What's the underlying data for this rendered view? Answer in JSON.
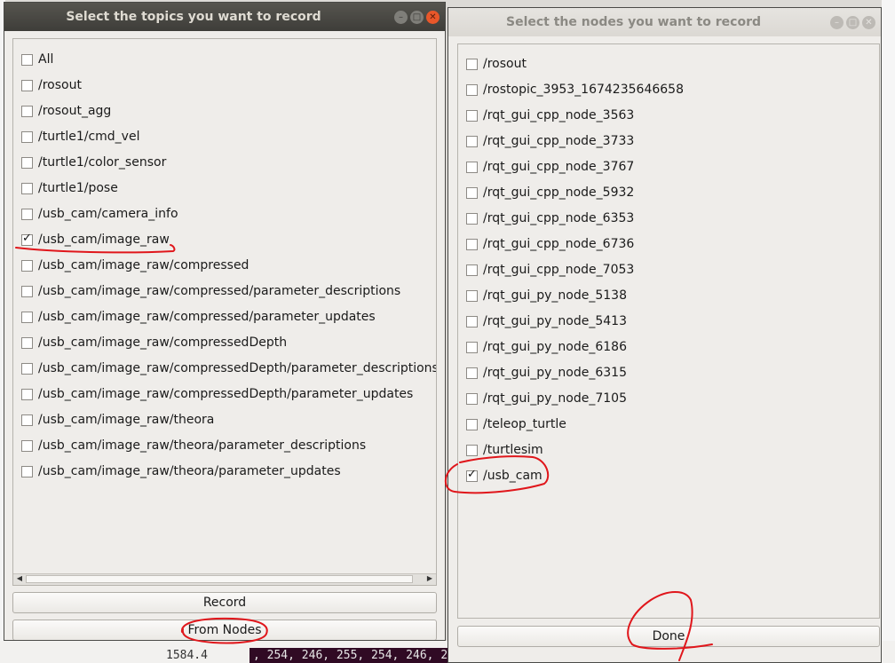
{
  "background": {
    "number": "1584.4",
    "terminal_text": ", 254, 246, 255, 254, 246, 2"
  },
  "topics_window": {
    "title": "Select the topics you want to record",
    "items": [
      {
        "label": "All",
        "checked": false
      },
      {
        "label": "/rosout",
        "checked": false
      },
      {
        "label": "/rosout_agg",
        "checked": false
      },
      {
        "label": "/turtle1/cmd_vel",
        "checked": false
      },
      {
        "label": "/turtle1/color_sensor",
        "checked": false
      },
      {
        "label": "/turtle1/pose",
        "checked": false
      },
      {
        "label": "/usb_cam/camera_info",
        "checked": false
      },
      {
        "label": "/usb_cam/image_raw",
        "checked": true
      },
      {
        "label": "/usb_cam/image_raw/compressed",
        "checked": false
      },
      {
        "label": "/usb_cam/image_raw/compressed/parameter_descriptions",
        "checked": false
      },
      {
        "label": "/usb_cam/image_raw/compressed/parameter_updates",
        "checked": false
      },
      {
        "label": "/usb_cam/image_raw/compressedDepth",
        "checked": false
      },
      {
        "label": "/usb_cam/image_raw/compressedDepth/parameter_descriptions",
        "checked": false
      },
      {
        "label": "/usb_cam/image_raw/compressedDepth/parameter_updates",
        "checked": false
      },
      {
        "label": "/usb_cam/image_raw/theora",
        "checked": false
      },
      {
        "label": "/usb_cam/image_raw/theora/parameter_descriptions",
        "checked": false
      },
      {
        "label": "/usb_cam/image_raw/theora/parameter_updates",
        "checked": false
      }
    ],
    "record_label": "Record",
    "from_nodes_label": "From Nodes"
  },
  "nodes_window": {
    "title": "Select the nodes you want to record",
    "items": [
      {
        "label": "/rosout",
        "checked": false
      },
      {
        "label": "/rostopic_3953_1674235646658",
        "checked": false
      },
      {
        "label": "/rqt_gui_cpp_node_3563",
        "checked": false
      },
      {
        "label": "/rqt_gui_cpp_node_3733",
        "checked": false
      },
      {
        "label": "/rqt_gui_cpp_node_3767",
        "checked": false
      },
      {
        "label": "/rqt_gui_cpp_node_5932",
        "checked": false
      },
      {
        "label": "/rqt_gui_cpp_node_6353",
        "checked": false
      },
      {
        "label": "/rqt_gui_cpp_node_6736",
        "checked": false
      },
      {
        "label": "/rqt_gui_cpp_node_7053",
        "checked": false
      },
      {
        "label": "/rqt_gui_py_node_5138",
        "checked": false
      },
      {
        "label": "/rqt_gui_py_node_5413",
        "checked": false
      },
      {
        "label": "/rqt_gui_py_node_6186",
        "checked": false
      },
      {
        "label": "/rqt_gui_py_node_6315",
        "checked": false
      },
      {
        "label": "/rqt_gui_py_node_7105",
        "checked": false
      },
      {
        "label": "/teleop_turtle",
        "checked": false
      },
      {
        "label": "/turtlesim",
        "checked": false
      },
      {
        "label": "/usb_cam",
        "checked": true
      }
    ],
    "done_label": "Done"
  },
  "annotation_color": "#e0161b"
}
